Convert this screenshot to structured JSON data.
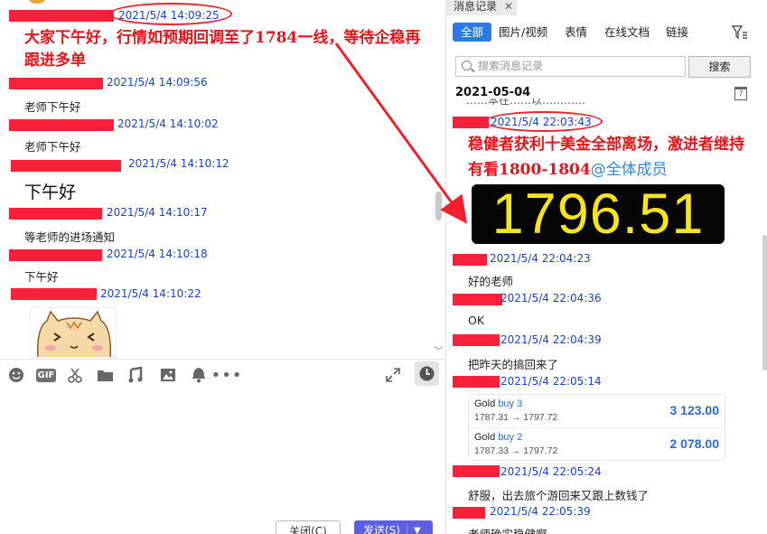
{
  "left": {
    "messages": [
      {
        "ts": "2021/5/4 14:09:25"
      },
      {
        "ts": "2021/5/4 14:09:56",
        "text": "老师下午好"
      },
      {
        "ts": "2021/5/4 14:10:02",
        "text": "老师下午好"
      },
      {
        "ts": "2021/5/4 14:10:12",
        "text": "下午好"
      },
      {
        "ts": "2021/5/4 14:10:17",
        "text": "等老师的进场通知"
      },
      {
        "ts": "2021/5/4 14:10:18",
        "text": "下午好"
      },
      {
        "ts": "2021/5/4 14:10:22"
      }
    ],
    "annotation": "大家下午好，行情如预期回调至了1784一线，等待企稳再跟进多单",
    "toolbar_icons": [
      "emoji-icon",
      "gif-icon",
      "scissors-icon",
      "folder-icon",
      "music-icon",
      "image-icon",
      "bell-icon",
      "more-icon"
    ],
    "gif_label": "GIF",
    "close_button": "关闭(C)",
    "send_button": "发送(S)"
  },
  "right": {
    "tab_title": "消息记录",
    "filters": [
      "全部",
      "图片/视频",
      "表情",
      "在线文档",
      "链接"
    ],
    "search_placeholder": "搜索消息记录",
    "search_button": "搜索",
    "date_header": "2021-05-04",
    "cal_day": "7",
    "partial_top": "……本在……以…………",
    "highlight_ts": "2021/5/4 22:03:43",
    "annotation": "稳健者获利十美金全部离场，激进者继持有看1800-1804",
    "mention": "@全体成员",
    "price": "1796.51",
    "messages": [
      {
        "ts": "2021/5/4 22:04:23",
        "text": "好的老师"
      },
      {
        "ts": "2021/5/4 22:04:36",
        "text": "OK"
      },
      {
        "ts": "2021/5/4 22:04:39",
        "text": "把昨天的搞回来了"
      },
      {
        "ts": "2021/5/4 22:05:14"
      },
      {
        "ts": "2021/5/4 22:05:24",
        "text": "舒服，出去旅个游回来又跟上数钱了"
      },
      {
        "ts": "2021/5/4 22:05:39",
        "text": "老师确实稳健啊"
      }
    ],
    "trades": [
      {
        "symbol": "Gold",
        "direction": "buy 3",
        "prices": "1787.31 → 1797.72",
        "profit": "3 123.00"
      },
      {
        "symbol": "Gold",
        "direction": "buy 2",
        "prices": "1787.33 → 1797.72",
        "profit": "2 078.00"
      }
    ],
    "colors": {
      "accent": "#2c7be5",
      "redact": "#f8203a",
      "annotation": "#e8141c",
      "price_text": "#f7e21e"
    }
  }
}
